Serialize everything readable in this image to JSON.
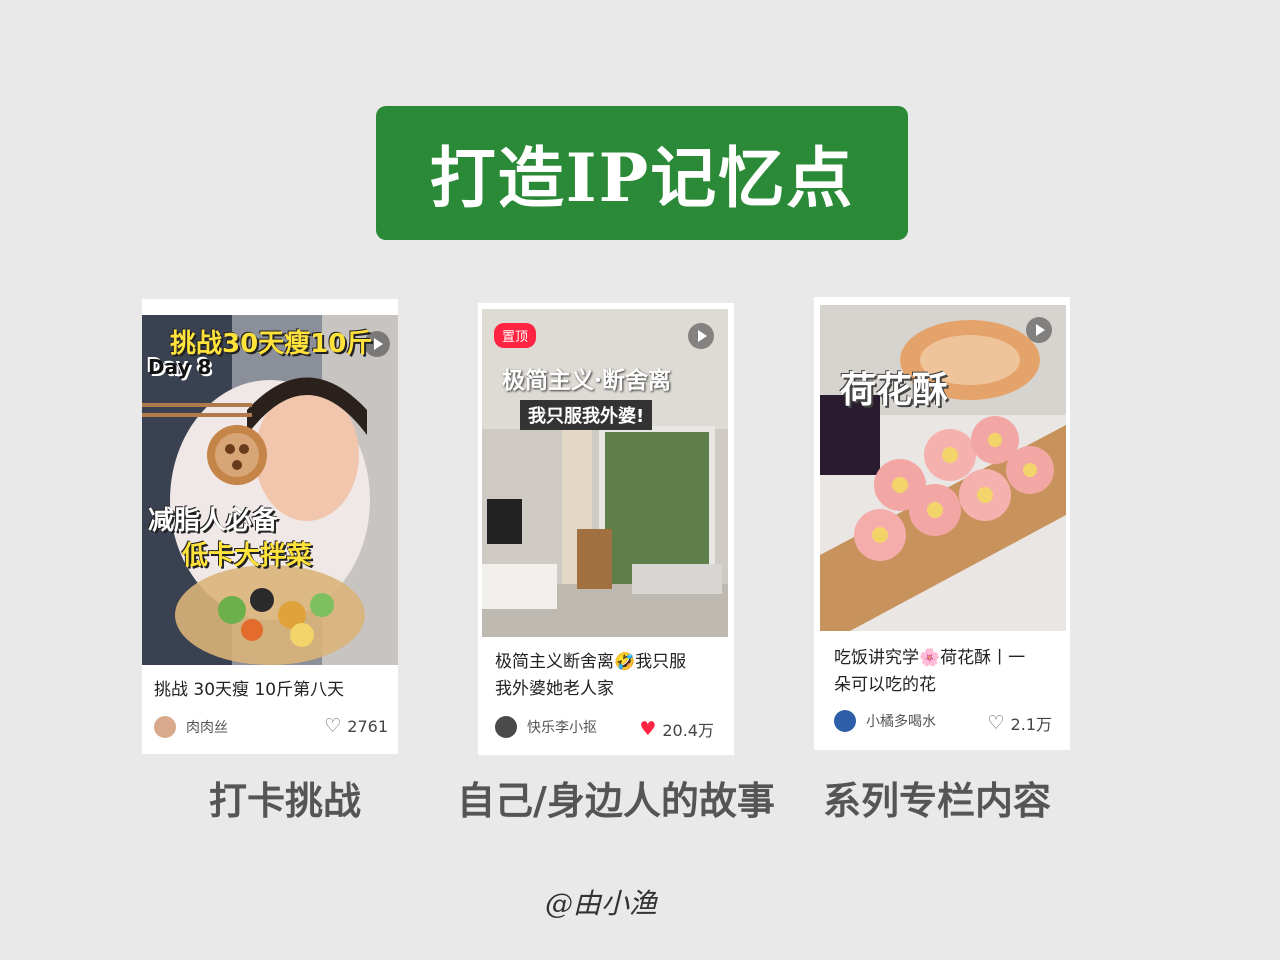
{
  "title": "打造IP记忆点",
  "cards": [
    {
      "overlay_top": "挑战30天瘦10斤",
      "overlay_day": "Day 8",
      "overlay_bottom_1": "减脂人必备",
      "overlay_bottom_2": "低卡大拌菜",
      "caption": "挑战 30天瘦 10斤第八天",
      "author": "肉肉丝",
      "likes": "2761",
      "liked": false,
      "category": "打卡挑战"
    },
    {
      "pin_badge": "置顶",
      "overlay_top": "极简主义·断舍离",
      "overlay_sub": "我只服我外婆!",
      "caption_line1": "极简主义断舍离🤣我只服",
      "caption_line2": "我外婆她老人家",
      "author": "快乐李小抠",
      "likes": "20.4万",
      "liked": true,
      "category": "自己/身边人的故事"
    },
    {
      "overlay_top": "荷花酥",
      "caption_line1": "吃饭讲究学🌸荷花酥丨一",
      "caption_line2": "朵可以吃的花",
      "author": "小橘多喝水",
      "likes": "2.1万",
      "liked": false,
      "category": "系列专栏内容"
    }
  ],
  "watermark": "@由小渔",
  "colors": {
    "banner": "#2b8a37",
    "pin_badge": "#ff2442",
    "liked_heart": "#ff2442",
    "overlay_yellow": "#ffe23a"
  }
}
